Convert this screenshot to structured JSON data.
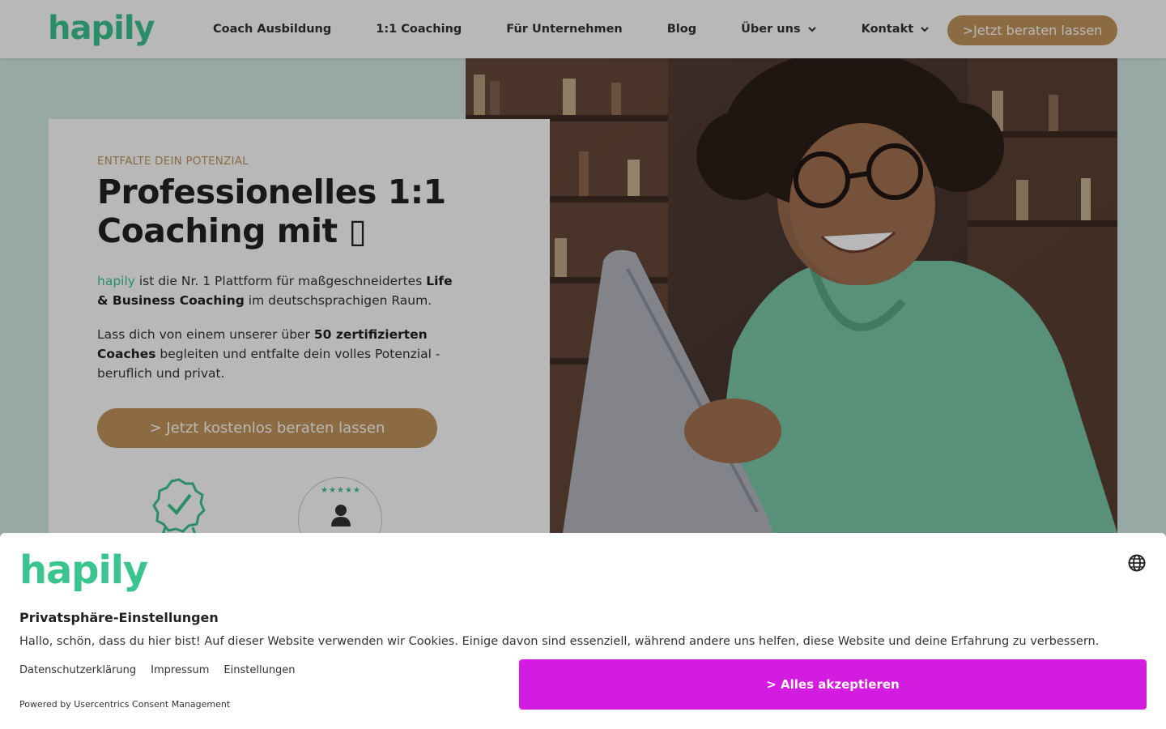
{
  "colors": {
    "brand_green": "#3cc48f",
    "accent_gold": "#c4955c",
    "accept_magenta": "#d41ce0",
    "page_bg": "#d3e9e4"
  },
  "header": {
    "logo": "hapily",
    "nav": [
      {
        "label": "Coach Ausbildung",
        "dropdown": false
      },
      {
        "label": "1:1 Coaching",
        "dropdown": false
      },
      {
        "label": "Für Unternehmen",
        "dropdown": false
      },
      {
        "label": "Blog",
        "dropdown": false
      },
      {
        "label": "Über uns",
        "dropdown": true
      },
      {
        "label": "Kontakt",
        "dropdown": true
      }
    ],
    "cta": ">Jetzt beraten lassen"
  },
  "hero": {
    "eyebrow": "ENTFALTE DEIN POTENZIAL",
    "headline_line1": "Professionelles 1:1",
    "headline_line2": "Coaching mit ▯",
    "p1": {
      "brand": "hapily",
      "t1": " ist die Nr. 1 Plattform für maßgeschneidertes ",
      "b1": "Life & Business Coaching",
      "t2": " im deutschsprachigen Raum."
    },
    "p2": {
      "t1": "Lass dich von einem unserer über ",
      "b1": "50 zertifizierten Coaches",
      "t2": " begleiten und entfalte dein volles Potenzial - beruflich und privat."
    },
    "cta": "> Jetzt kostenlos beraten lassen",
    "badge_stars": "★★★★★",
    "badge_icons": [
      "certified-badge-icon",
      "coach-rating-badge-icon"
    ]
  },
  "cookie": {
    "logo": "hapily",
    "title": "Privatsphäre-Einstellungen",
    "text": "Hallo, schön, dass du hier bist! Auf dieser Website verwenden wir Cookies. Einige davon sind essenziell, während andere uns helfen, diese Website und deine Erfahrung zu verbessern.",
    "links": [
      "Datenschutzerklärung",
      "Impressum",
      "Einstellungen"
    ],
    "accept": "> Alles akzeptieren",
    "powered": "Powered by Usercentrics Consent Management"
  }
}
